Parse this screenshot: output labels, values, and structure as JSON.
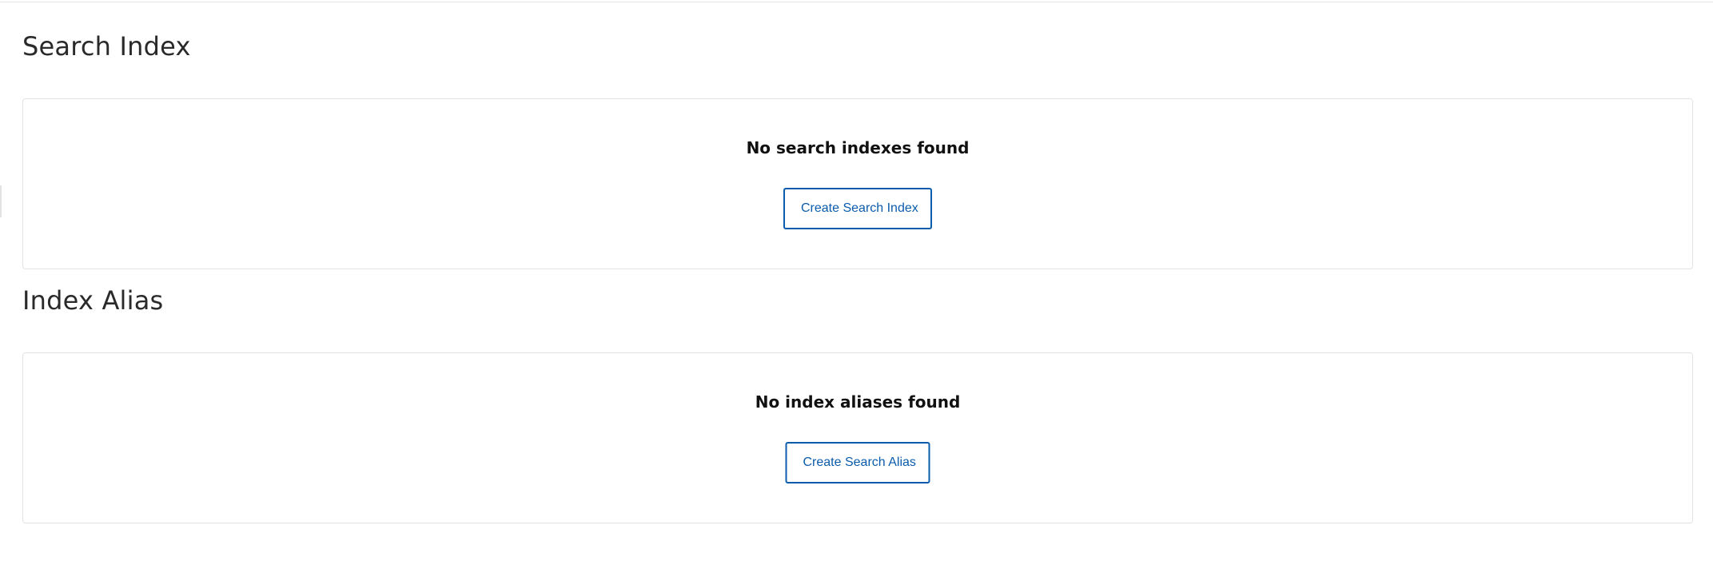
{
  "colors": {
    "accent": "#0b5cad",
    "panel_border": "#e3e3e3",
    "heading_text": "#2a2a2a",
    "message_text": "#111111"
  },
  "search_index": {
    "title": "Search Index",
    "empty_message": "No search indexes found",
    "create_button_label": "Create Search Index"
  },
  "index_alias": {
    "title": "Index Alias",
    "empty_message": "No index aliases found",
    "create_button_label": "Create Search Alias"
  }
}
